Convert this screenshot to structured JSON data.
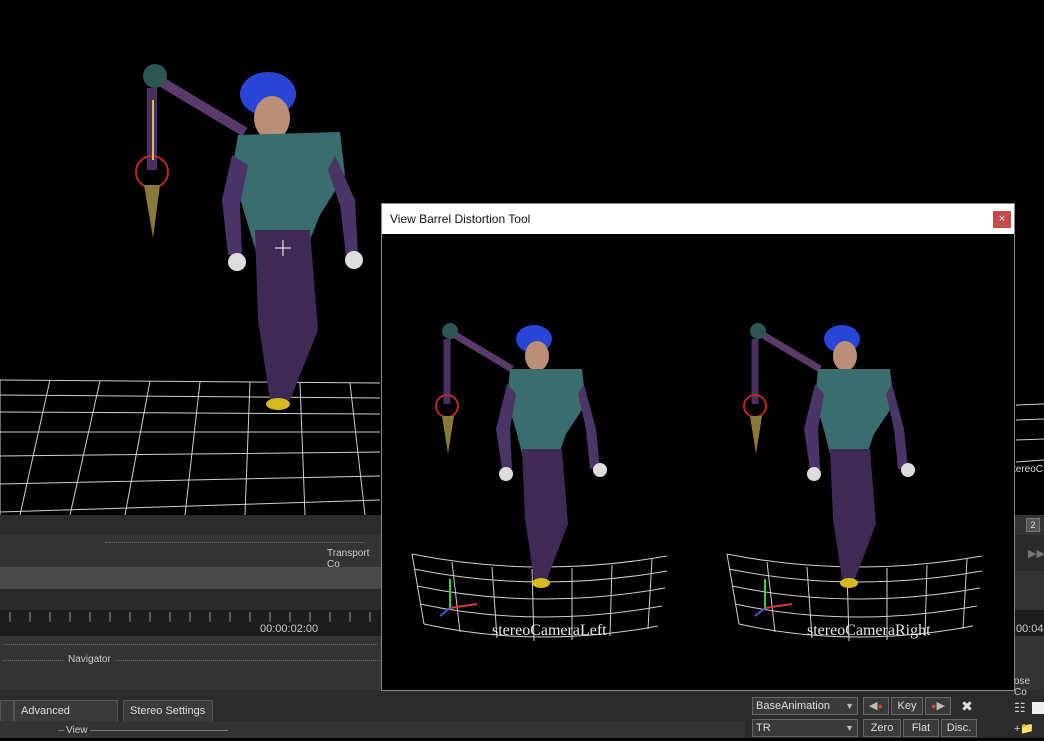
{
  "dialog": {
    "title": "View Barrel Distortion Tool",
    "close_icon": "×",
    "left_camera_label": "stereoCameraLeft",
    "right_camera_label": "stereoCameraRight"
  },
  "panels": {
    "transport_controls_label": "Transport Co",
    "navigator_label": "Navigator",
    "pose_controls_label": "ose Co",
    "stereo_partial": "tereoC",
    "tab_number": "2"
  },
  "timeline": {
    "current_time": "00:00:02:00",
    "right_time": "00:04"
  },
  "bottom_tabs": [
    {
      "label": "Advanced Settings"
    },
    {
      "label": "Stereo Settings"
    }
  ],
  "view_group_label": "View",
  "animation_controls": {
    "layer_select": "BaseAnimation",
    "mode_select": "TR",
    "key_button": "Key",
    "zero_button": "Zero",
    "flat_button": "Flat",
    "disc_button": "Disc.",
    "close_icon": "✖"
  },
  "colors": {
    "dialog_close_bg": "#c64b4b",
    "panel_bg": "#2b2b2b"
  }
}
